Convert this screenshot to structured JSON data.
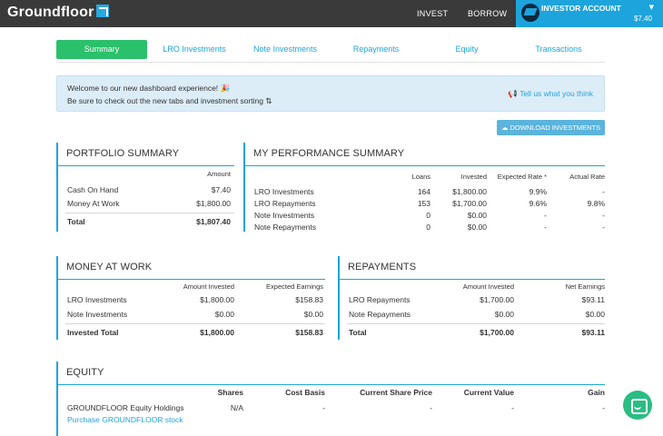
{
  "header": {
    "logo_text": "Groundfloor",
    "nav": [
      "INVEST",
      "BORROW"
    ],
    "account_label": "INVESTOR ACCOUNT",
    "account_balance": "$7.40"
  },
  "tabs": [
    "Summary",
    "LRO Investments",
    "Note Investments",
    "Repayments",
    "Equity",
    "Transactions"
  ],
  "banner": {
    "line1": "Welcome to our new dashboard experience!",
    "line2": "Be sure to check out the new tabs and investment sorting",
    "feedback_link": "Tell us what you think"
  },
  "download_label": "DOWNLOAD INVESTMENTS",
  "portfolio_summary": {
    "title": "PORTFOLIO SUMMARY",
    "col": "Amount",
    "rows": [
      {
        "label": "Cash On Hand",
        "amount": "$7.40"
      },
      {
        "label": "Money At Work",
        "amount": "$1,800.00"
      }
    ],
    "total_label": "Total",
    "total_amount": "$1,807.40"
  },
  "performance_summary": {
    "title": "MY PERFORMANCE SUMMARY",
    "cols": [
      "Loans",
      "Invested",
      "Expected Rate *",
      "Actual Rate"
    ],
    "rows": [
      {
        "label": "LRO Investments",
        "loans": "164",
        "invested": "$1,800.00",
        "expected": "9.9%",
        "actual": "-"
      },
      {
        "label": "LRO Repayments",
        "loans": "153",
        "invested": "$1,700.00",
        "expected": "9.6%",
        "actual": "9.8%"
      },
      {
        "label": "Note Investments",
        "loans": "0",
        "invested": "$0.00",
        "expected": "-",
        "actual": "-"
      },
      {
        "label": "Note Repayments",
        "loans": "0",
        "invested": "$0.00",
        "expected": "-",
        "actual": "-"
      }
    ]
  },
  "money_at_work": {
    "title": "MONEY AT WORK",
    "cols": [
      "Amount Invested",
      "Expected Earnings"
    ],
    "rows": [
      {
        "label": "LRO Investments",
        "a": "$1,800.00",
        "b": "$158.83"
      },
      {
        "label": "Note Investments",
        "a": "$0.00",
        "b": "$0.00"
      }
    ],
    "total": {
      "label": "Invested Total",
      "a": "$1,800.00",
      "b": "$158.83"
    }
  },
  "repayments": {
    "title": "REPAYMENTS",
    "cols": [
      "Amount Invested",
      "Net Earnings"
    ],
    "rows": [
      {
        "label": "LRO Repayments",
        "a": "$1,700.00",
        "b": "$93.11"
      },
      {
        "label": "Note Repayments",
        "a": "$0.00",
        "b": "$0.00"
      }
    ],
    "total": {
      "label": "Total",
      "a": "$1,700.00",
      "b": "$93.11"
    }
  },
  "equity": {
    "title": "EQUITY",
    "cols": [
      "Shares",
      "Cost Basis",
      "Current Share Price",
      "Current Value",
      "Gain"
    ],
    "row": {
      "label": "GROUNDFLOOR Equity Holdings",
      "shares": "N/A",
      "cost": "-",
      "price": "-",
      "value": "-",
      "gain": "-"
    },
    "purchase_link": "Purchase GROUNDFLOOR stock"
  }
}
